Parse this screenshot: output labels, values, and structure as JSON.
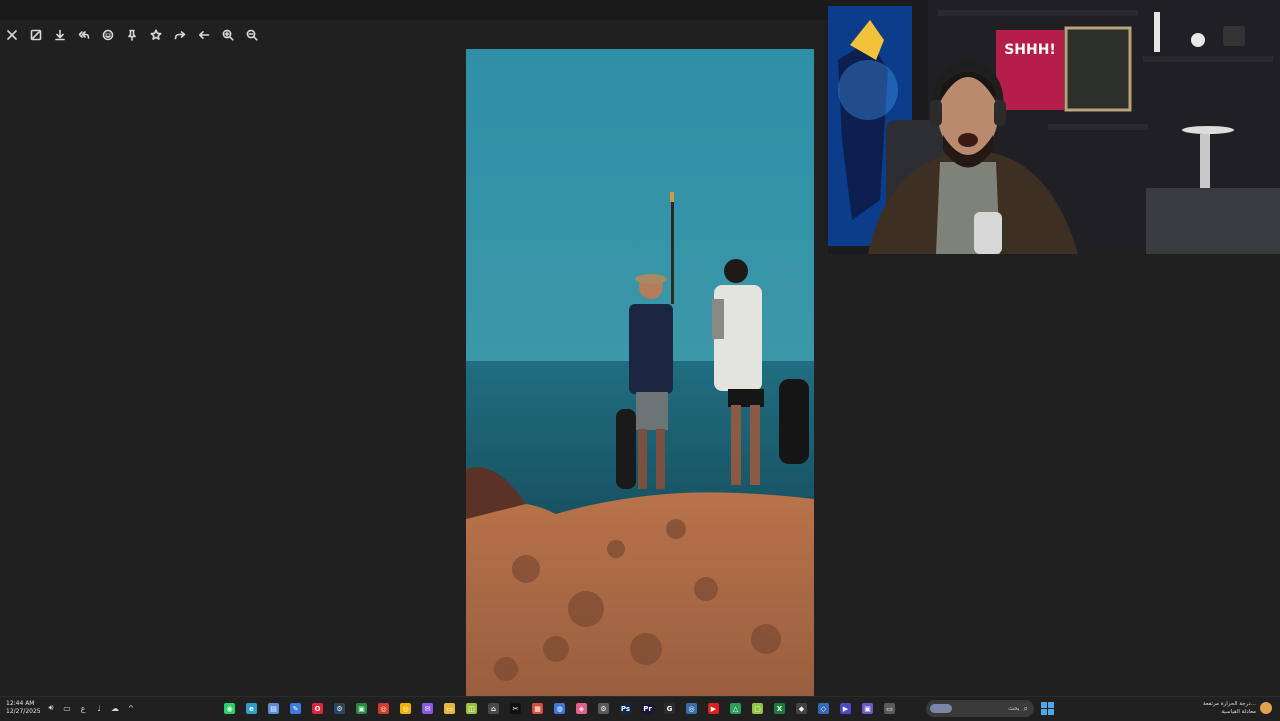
{
  "toolbar": {
    "buttons": [
      {
        "name": "close-icon",
        "label": "Close"
      },
      {
        "name": "fit-screen-icon",
        "label": "Fit"
      },
      {
        "name": "download-icon",
        "label": "Download"
      },
      {
        "name": "reply-all-icon",
        "label": "Reply all"
      },
      {
        "name": "emoji-icon",
        "label": "React"
      },
      {
        "name": "pin-icon",
        "label": "Pin"
      },
      {
        "name": "star-icon",
        "label": "Star"
      },
      {
        "name": "forward-icon",
        "label": "Forward"
      },
      {
        "name": "back-arrow-icon",
        "label": "Back"
      },
      {
        "name": "zoom-in-icon",
        "label": "Zoom in"
      },
      {
        "name": "zoom-out-icon",
        "label": "Zoom out"
      }
    ]
  },
  "viewer": {
    "image_subject": "two-people-on-rocky-shore-by-sea"
  },
  "webcam": {
    "sign_text": "SHHH!"
  },
  "taskbar": {
    "time": "12:44 AM",
    "date": "12/27/2025",
    "tray_lang": "ع",
    "search_placeholder": "بحث",
    "weather_line1": "درجة الحرارة مرتفعة...",
    "weather_line2": "معادلة القياسية",
    "apps": [
      {
        "name": "whatsapp",
        "color": "#25d366",
        "glyph": "◉"
      },
      {
        "name": "browser-edge",
        "color": "#2fa0c8",
        "glyph": "e"
      },
      {
        "name": "notepad",
        "color": "#5b8dd6",
        "glyph": "▤"
      },
      {
        "name": "edit",
        "color": "#3d7be0",
        "glyph": "✎"
      },
      {
        "name": "opera",
        "color": "#e2243c",
        "glyph": "O"
      },
      {
        "name": "steam",
        "color": "#2a475e",
        "glyph": "⚙"
      },
      {
        "name": "xbox",
        "color": "#1f8f3a",
        "glyph": "▣"
      },
      {
        "name": "chrome-alt",
        "color": "#d23c2f",
        "glyph": "◎"
      },
      {
        "name": "chrome",
        "color": "#f0b400",
        "glyph": "◎"
      },
      {
        "name": "messenger",
        "color": "#8b58e8",
        "glyph": "✉"
      },
      {
        "name": "explorer",
        "color": "#e8b83c",
        "glyph": "▭"
      },
      {
        "name": "app-green",
        "color": "#98c23a",
        "glyph": "◫"
      },
      {
        "name": "store",
        "color": "#4a4a4a",
        "glyph": "⌂"
      },
      {
        "name": "capcut",
        "color": "#111111",
        "glyph": "✂"
      },
      {
        "name": "app-red",
        "color": "#d84a3a",
        "glyph": "▦"
      },
      {
        "name": "app-blue",
        "color": "#3f74d8",
        "glyph": "◍"
      },
      {
        "name": "app-multi",
        "color": "#e35f92",
        "glyph": "◈"
      },
      {
        "name": "settings",
        "color": "#5a5a5a",
        "glyph": "⚙"
      },
      {
        "name": "photoshop",
        "color": "#0a2a4a",
        "glyph": "Ps"
      },
      {
        "name": "premiere",
        "color": "#1d1442",
        "glyph": "Pr"
      },
      {
        "name": "google",
        "color": "#2c2c2c",
        "glyph": "G"
      },
      {
        "name": "chrome-2",
        "color": "#3a6ea8",
        "glyph": "◎"
      },
      {
        "name": "youtube",
        "color": "#e02020",
        "glyph": "▶"
      },
      {
        "name": "drive",
        "color": "#2b9e58",
        "glyph": "△"
      },
      {
        "name": "sticky",
        "color": "#8fc542",
        "glyph": "▢"
      },
      {
        "name": "excel",
        "color": "#1e7a3e",
        "glyph": "X"
      },
      {
        "name": "game",
        "color": "#444444",
        "glyph": "◆"
      },
      {
        "name": "vpn",
        "color": "#3568b8",
        "glyph": "◇"
      },
      {
        "name": "media",
        "color": "#4a4ac8",
        "glyph": "▶"
      },
      {
        "name": "app-purple",
        "color": "#6a5ac8",
        "glyph": "▣"
      },
      {
        "name": "desktop",
        "color": "#5a5a5a",
        "glyph": "▭"
      }
    ]
  }
}
